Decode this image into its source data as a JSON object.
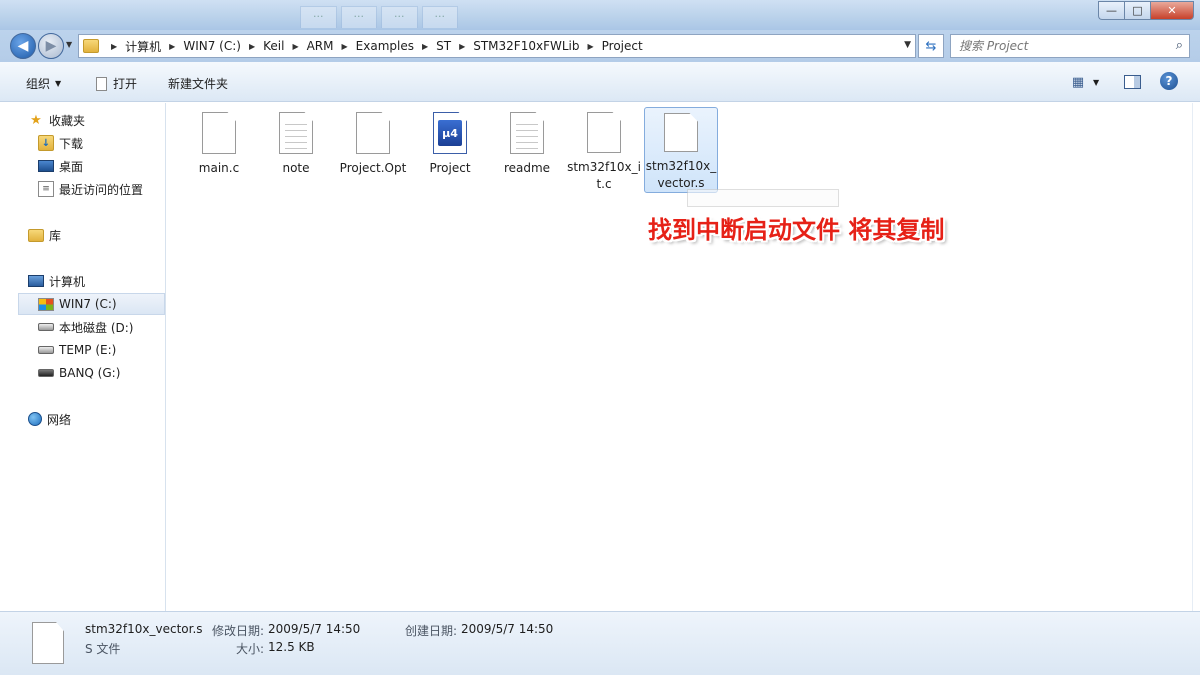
{
  "window": {
    "ghost_tabs": [
      "···",
      "···",
      "···",
      "···"
    ],
    "minimize": "—",
    "maximize": "□",
    "close": "✕"
  },
  "address": {
    "crumbs": [
      "计算机",
      "WIN7 (C:)",
      "Keil",
      "ARM",
      "Examples",
      "ST",
      "STM32F10xFWLib",
      "Project"
    ],
    "search_placeholder": "搜索 Project"
  },
  "toolbar": {
    "organize": "组织",
    "open": "打开",
    "new_folder": "新建文件夹"
  },
  "sidebar": {
    "favorites": "收藏夹",
    "downloads": "下载",
    "desktop": "桌面",
    "recent": "最近访问的位置",
    "libraries": "库",
    "computer": "计算机",
    "drive_c": "WIN7 (C:)",
    "drive_d": "本地磁盘 (D:)",
    "drive_e": "TEMP (E:)",
    "drive_g": "BANQ (G:)",
    "network": "网络"
  },
  "files": [
    {
      "name": "main.c",
      "icon": "generic-file-icon"
    },
    {
      "name": "note",
      "icon": "text-file-icon"
    },
    {
      "name": "Project.Opt",
      "icon": "generic-file-icon"
    },
    {
      "name": "Project",
      "icon": "uvision-project-icon"
    },
    {
      "name": "readme",
      "icon": "text-file-icon"
    },
    {
      "name": "stm32f10x_it.c",
      "icon": "generic-file-icon"
    },
    {
      "name": "stm32f10x_vector.s",
      "icon": "generic-file-icon",
      "selected": true
    }
  ],
  "annotation": "找到中断启动文件 将其复制",
  "details": {
    "filename": "stm32f10x_vector.s",
    "type": "S 文件",
    "modified_label": "修改日期:",
    "modified_value": "2009/5/7 14:50",
    "size_label": "大小:",
    "size_value": "12.5 KB",
    "created_label": "创建日期:",
    "created_value": "2009/5/7 14:50"
  }
}
